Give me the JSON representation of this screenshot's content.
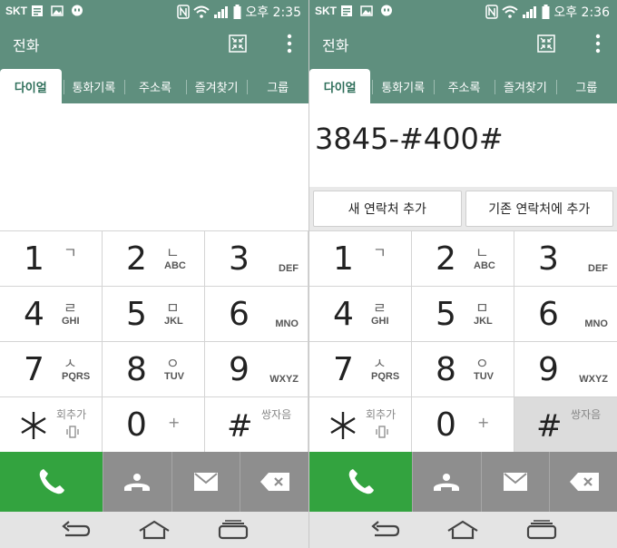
{
  "screens": [
    {
      "status": {
        "carrier": "SKT",
        "time": "오후 2:35"
      },
      "app_title": "전화",
      "tabs": [
        "다이얼",
        "통화기록",
        "주소록",
        "즐겨찾기",
        "그룹"
      ],
      "active_tab": 0,
      "dialed_number": "",
      "add_buttons": [],
      "keys": [
        {
          "digit": "1",
          "hangul": "ㄱ",
          "letters": ""
        },
        {
          "digit": "2",
          "hangul": "ㄴ",
          "letters": "ABC"
        },
        {
          "digit": "3",
          "hangul": "",
          "letters": "DEF"
        },
        {
          "digit": "4",
          "hangul": "ㄹ",
          "letters": "GHI"
        },
        {
          "digit": "5",
          "hangul": "ㅁ",
          "letters": "JKL"
        },
        {
          "digit": "6",
          "hangul": "",
          "letters": "MNO"
        },
        {
          "digit": "7",
          "hangul": "ㅅ",
          "letters": "PQRS"
        },
        {
          "digit": "8",
          "hangul": "ㅇ",
          "letters": "TUV"
        },
        {
          "digit": "9",
          "hangul": "",
          "letters": "WXYZ"
        }
      ],
      "star_label": "회추가",
      "zero_label": "+",
      "hash_label": "쌍자음",
      "hash_pressed": false
    },
    {
      "status": {
        "carrier": "SKT",
        "time": "오후 2:36"
      },
      "app_title": "전화",
      "tabs": [
        "다이얼",
        "통화기록",
        "주소록",
        "즐겨찾기",
        "그룹"
      ],
      "active_tab": 0,
      "dialed_number": "3845-#400#",
      "add_buttons": [
        "새 연락처 추가",
        "기존 연락처에 추가"
      ],
      "keys": [
        {
          "digit": "1",
          "hangul": "ㄱ",
          "letters": ""
        },
        {
          "digit": "2",
          "hangul": "ㄴ",
          "letters": "ABC"
        },
        {
          "digit": "3",
          "hangul": "",
          "letters": "DEF"
        },
        {
          "digit": "4",
          "hangul": "ㄹ",
          "letters": "GHI"
        },
        {
          "digit": "5",
          "hangul": "ㅁ",
          "letters": "JKL"
        },
        {
          "digit": "6",
          "hangul": "",
          "letters": "MNO"
        },
        {
          "digit": "7",
          "hangul": "ㅅ",
          "letters": "PQRS"
        },
        {
          "digit": "8",
          "hangul": "ㅇ",
          "letters": "TUV"
        },
        {
          "digit": "9",
          "hangul": "",
          "letters": "WXYZ"
        }
      ],
      "star_label": "회추가",
      "zero_label": "+",
      "hash_label": "쌍자음",
      "hash_pressed": true
    }
  ],
  "colors": {
    "header": "#5f8f7e",
    "call": "#33a33f",
    "action_grey": "#8e8e8e"
  }
}
